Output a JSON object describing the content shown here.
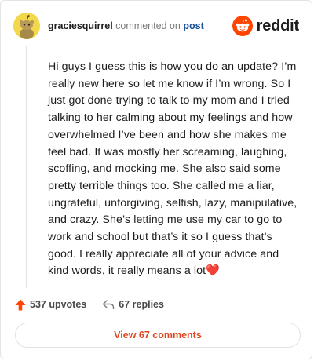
{
  "comment": {
    "username": "graciesquirrel",
    "action": "commented on",
    "target": "post",
    "body": "Hi guys I guess this is how you do an update? I’m really new here so let me know if I’m wrong. So I just got done trying to talk to my mom and I tried talking to her calming about my feelings and how overwhelmed I’ve been and how she makes me feel bad. It was mostly her screaming, laughing, scoffing, and mocking me. She also said some pretty terrible things too. She called me a liar, ungrateful, unforgiving, selfish, lazy, manipulative, and crazy. She’s letting me use my car to go to work and school but that’s it so I guess that’s good. I really appreciate all of your advice and kind words, it really means a lot",
    "emoji": "❤️",
    "upvotes": "537 upvotes",
    "replies": "67 replies",
    "view_comments": "View 67 comments"
  },
  "brand": {
    "name": "reddit",
    "color": "#ff4500"
  },
  "icons": {
    "avatar": "snoo-avatar",
    "logo": "reddit-logo-icon",
    "upvote": "upvote-arrow-icon",
    "reply": "reply-arrow-icon"
  }
}
